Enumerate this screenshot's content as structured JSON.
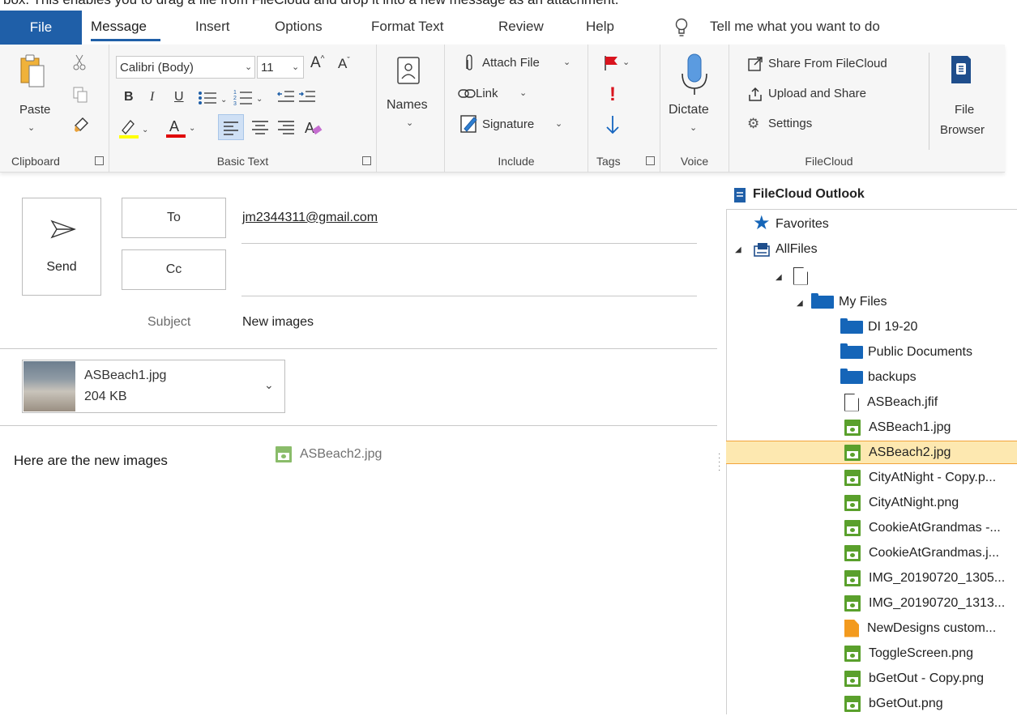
{
  "caption": "box.  This enables you to drag a file from FileCloud and drop it into a new message as an attachment.",
  "tabs": [
    "File",
    "Message",
    "Insert",
    "Options",
    "Format Text",
    "Review",
    "Help"
  ],
  "tell_me": "Tell me what you want to do",
  "ribbon": {
    "paste": "Paste",
    "font_name": "Calibri (Body)",
    "font_size": "11",
    "names": "Names",
    "attach_file": "Attach File",
    "link": "Link",
    "signature": "Signature",
    "dictate": "Dictate",
    "share_from_filecloud": "Share From FileCloud",
    "upload_and_share": "Upload and Share",
    "settings": "Settings",
    "file_browser_1": "File",
    "file_browser_2": "Browser",
    "groups": {
      "clipboard": "Clipboard",
      "basic_text": "Basic Text",
      "include": "Include",
      "tags": "Tags",
      "voice": "Voice",
      "filecloud": "FileCloud"
    },
    "colors": {
      "highlight": "#ffff00",
      "font_color": "#e00000",
      "flag": "#d9141e",
      "tags_arrow": "#1565c0"
    }
  },
  "compose": {
    "send": "Send",
    "to_label": "To",
    "cc_label": "Cc",
    "to_value": "jm2344311@gmail.com",
    "cc_value": "",
    "subject_label": "Subject",
    "subject_value": "New images",
    "attachment": {
      "name": "ASBeach1.jpg",
      "size": "204 KB"
    },
    "body": "Here are the new images",
    "dragging_file": "ASBeach2.jpg"
  },
  "pane": {
    "title": "FileCloud Outlook",
    "favorites": "Favorites",
    "allfiles": "AllFiles",
    "myfiles": "My Files",
    "folders": [
      "DI 19-20",
      "Public Documents",
      "backups"
    ],
    "files": [
      {
        "name": "ASBeach.jfif",
        "icon": "document-icon"
      },
      {
        "name": "ASBeach1.jpg",
        "icon": "image-icon"
      },
      {
        "name": "ASBeach2.jpg",
        "icon": "image-icon",
        "selected": true
      },
      {
        "name": "CityAtNight - Copy.p...",
        "icon": "image-icon"
      },
      {
        "name": "CityAtNight.png",
        "icon": "image-icon"
      },
      {
        "name": "CookieAtGrandmas -...",
        "icon": "image-icon"
      },
      {
        "name": "CookieAtGrandmas.j...",
        "icon": "image-icon"
      },
      {
        "name": "IMG_20190720_1305...",
        "icon": "image-icon"
      },
      {
        "name": "IMG_20190720_1313...",
        "icon": "image-icon"
      },
      {
        "name": "NewDesigns custom...",
        "icon": "zip-icon"
      },
      {
        "name": "ToggleScreen.png",
        "icon": "image-icon"
      },
      {
        "name": "bGetOut - Copy.png",
        "icon": "image-icon"
      },
      {
        "name": "bGetOut.png",
        "icon": "image-icon"
      }
    ],
    "colors": {
      "selected_bg": "#fde8b0",
      "selected_border": "#f2a33a",
      "folder": "#1565b8",
      "image": "#5aa02c"
    }
  }
}
